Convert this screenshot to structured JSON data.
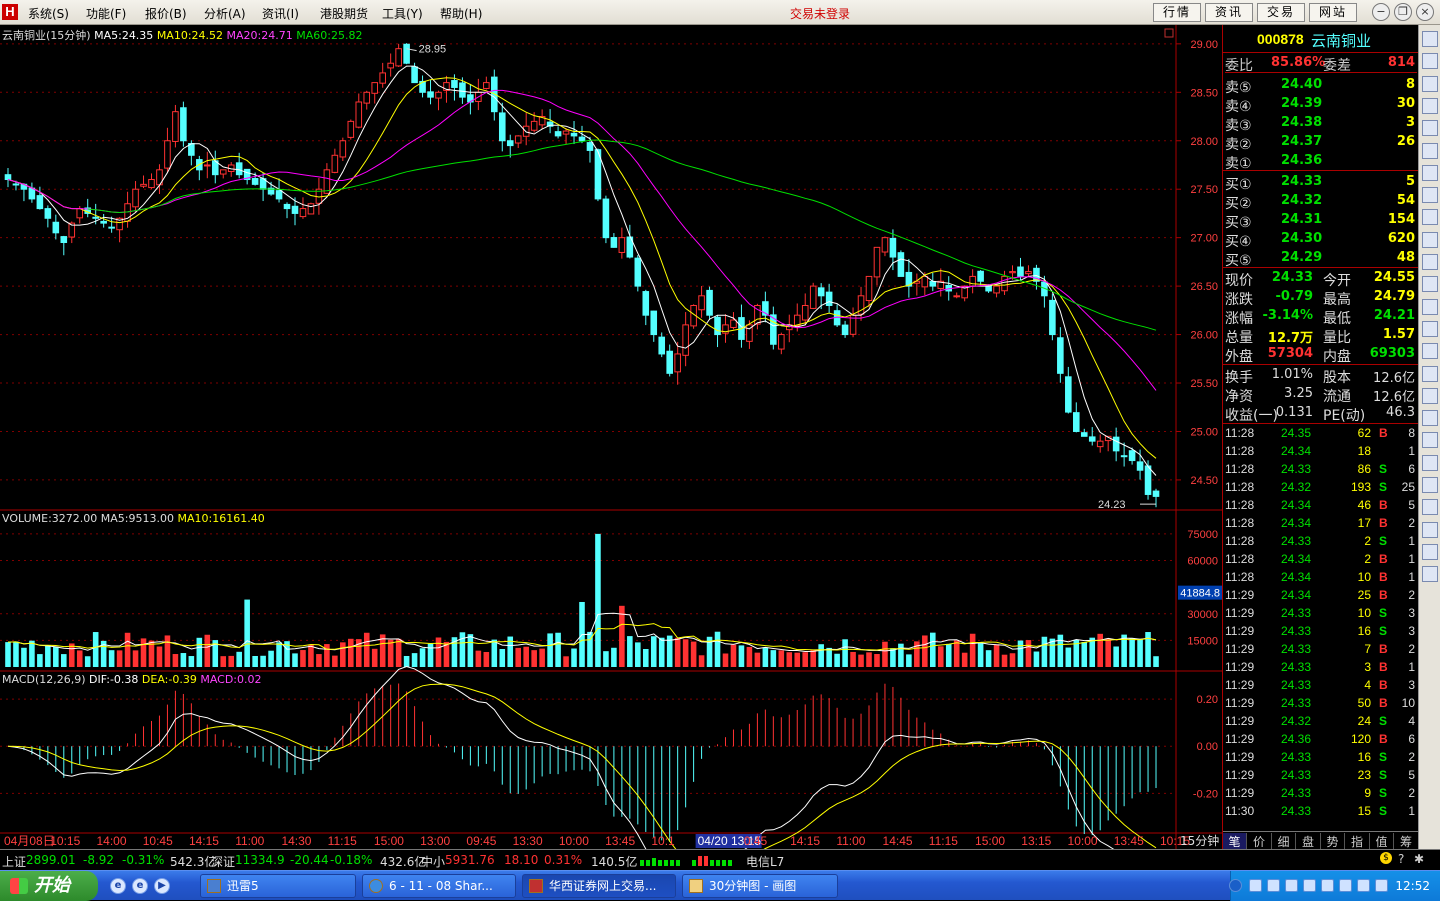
{
  "menu": {
    "items": [
      "系统(S)",
      "功能(F)",
      "报价(B)",
      "分析(A)",
      "资讯(I)",
      "港股期货",
      "工具(Y)",
      "帮助(H)"
    ],
    "login_status": "交易未登录",
    "buttons": [
      "行情",
      "资讯",
      "交易",
      "网站"
    ]
  },
  "chart": {
    "title": "云南铜业(15分钟)",
    "ma_labels": {
      "ma5": "MA5:24.35",
      "ma10": "MA10:24.52",
      "ma20": "MA20:24.71",
      "ma60": "MA60:25.82"
    },
    "high_label": "28.95",
    "low_label": "24.23",
    "price_ticks": [
      "29.00",
      "28.50",
      "28.00",
      "27.50",
      "27.00",
      "26.50",
      "26.00",
      "25.50",
      "25.00",
      "24.50"
    ],
    "volume_label": "VOLUME:3272.00",
    "vol_ma5_label": "MA5:9513.00",
    "vol_ma10_label": "MA10:16161.40",
    "vol_ticks": [
      "75000",
      "60000",
      "30000",
      "15000"
    ],
    "vol_cursor_value": "41884.8",
    "macd_label": "MACD(12,26,9)",
    "dif_label": "DIF:-0.38",
    "dea_label": "DEA:-0.39",
    "macd_value_label": "MACD:0.02",
    "macd_ticks": [
      "0.20",
      "0.00",
      "-0.20"
    ],
    "time_ticks": [
      "04月08日",
      "10:15",
      "14:00",
      "10:45",
      "14:15",
      "11:00",
      "14:30",
      "11:15",
      "15:00",
      "13:00",
      "09:45",
      "13:30",
      "10:00",
      "13:45",
      "10:1",
      "04/20 13:15",
      "0:45",
      "14:15",
      "11:00",
      "14:45",
      "11:15",
      "15:00",
      "13:15",
      "10:00",
      "13:45",
      "10:15"
    ],
    "period_label": "15分钟",
    "colors": {
      "up": "#ff3232",
      "down": "#54ffff",
      "ma5": "#ffffff",
      "ma10": "#ffff00",
      "ma20": "#ff00ff",
      "ma60": "#00e000",
      "grid": "#800000"
    }
  },
  "chart_data": {
    "type": "candlestick",
    "title": "云南铜业(15分钟)",
    "y_range": [
      24.2,
      29.05
    ],
    "price_close": [
      27.6,
      27.55,
      27.5,
      27.4,
      27.3,
      27.2,
      27.05,
      26.95,
      27.15,
      27.3,
      27.25,
      27.2,
      27.15,
      27.1,
      27.2,
      27.35,
      27.5,
      27.55,
      27.6,
      27.7,
      28.0,
      28.3,
      28.0,
      27.85,
      27.7,
      27.75,
      27.65,
      27.7,
      27.75,
      27.65,
      27.6,
      27.55,
      27.5,
      27.45,
      27.4,
      27.3,
      27.25,
      27.3,
      27.35,
      27.5,
      27.7,
      27.85,
      28.0,
      28.2,
      28.4,
      28.5,
      28.6,
      28.7,
      28.8,
      28.95,
      28.8,
      28.6,
      28.5,
      28.45,
      28.5,
      28.6,
      28.55,
      28.45,
      28.4,
      28.5,
      28.6,
      28.3,
      28.0,
      27.95,
      28.05,
      28.15,
      28.2,
      28.25,
      28.15,
      28.05,
      28.1,
      28.05,
      28.0,
      27.9,
      27.4,
      27.0,
      26.9,
      27.0,
      26.8,
      26.5,
      26.2,
      26.0,
      25.8,
      25.6,
      25.8,
      26.1,
      26.3,
      26.4,
      26.2,
      26.0,
      26.1,
      26.15,
      25.95,
      26.1,
      26.3,
      26.2,
      25.9,
      26.0,
      26.1,
      26.2,
      26.3,
      26.5,
      26.4,
      26.3,
      26.1,
      26.0,
      26.2,
      26.4,
      26.6,
      26.9,
      27.0,
      26.8,
      26.6,
      26.5,
      26.55,
      26.6,
      26.5,
      26.55,
      26.45,
      26.4,
      26.5,
      26.6,
      26.55,
      26.45,
      26.5,
      26.6,
      26.65,
      26.6,
      26.65,
      26.55,
      26.4,
      26.0,
      25.6,
      25.2,
      25.0,
      24.95,
      24.9,
      24.9,
      24.95,
      24.8,
      24.75,
      24.7,
      24.6,
      24.35,
      24.33
    ],
    "volume_range": [
      0,
      80000
    ],
    "macd": {
      "dif_last": -0.38,
      "dea_last": -0.39,
      "macd_last": 0.02,
      "y_range": [
        -0.36,
        0.26
      ]
    },
    "series": [
      {
        "name": "MA5",
        "last": 24.35
      },
      {
        "name": "MA10",
        "last": 24.52
      },
      {
        "name": "MA20",
        "last": 24.71
      },
      {
        "name": "MA60",
        "last": 25.82
      }
    ]
  },
  "panel": {
    "code": "000878",
    "name": "云南铜业",
    "weibi_label": "委比",
    "weibi_value": "85.86%",
    "weicha_label": "委差",
    "weicha_value": "814",
    "sells": [
      {
        "label": "卖⑤",
        "price": "24.40",
        "vol": "8"
      },
      {
        "label": "卖④",
        "price": "24.39",
        "vol": "30"
      },
      {
        "label": "卖③",
        "price": "24.38",
        "vol": "3"
      },
      {
        "label": "卖②",
        "price": "24.37",
        "vol": "26"
      },
      {
        "label": "卖①",
        "price": "24.36",
        "vol": ""
      }
    ],
    "buys": [
      {
        "label": "买①",
        "price": "24.33",
        "vol": "5"
      },
      {
        "label": "买②",
        "price": "24.32",
        "vol": "54"
      },
      {
        "label": "买③",
        "price": "24.31",
        "vol": "154"
      },
      {
        "label": "买④",
        "price": "24.30",
        "vol": "620"
      },
      {
        "label": "买⑤",
        "price": "24.29",
        "vol": "48"
      }
    ],
    "stats": [
      {
        "l1": "现价",
        "v1": "24.33",
        "c1": "#00e000",
        "l2": "今开",
        "v2": "24.55",
        "c2": "#ffff00"
      },
      {
        "l1": "涨跌",
        "v1": "-0.79",
        "c1": "#00e000",
        "l2": "最高",
        "v2": "24.79",
        "c2": "#ffff00"
      },
      {
        "l1": "涨幅",
        "v1": "-3.14%",
        "c1": "#00e000",
        "l2": "最低",
        "v2": "24.21",
        "c2": "#00e000"
      },
      {
        "l1": "总量",
        "v1": "12.7万",
        "c1": "#ffff00",
        "l2": "量比",
        "v2": "1.57",
        "c2": "#ffff00"
      },
      {
        "l1": "外盘",
        "v1": "57304",
        "c1": "#ff3232",
        "l2": "内盘",
        "v2": "69303",
        "c2": "#00e000"
      }
    ],
    "stats2": [
      {
        "l1": "换手",
        "v1": "1.01%",
        "l2": "股本",
        "v2": "12.6亿"
      },
      {
        "l1": "净资",
        "v1": "3.25",
        "l2": "流通",
        "v2": "12.6亿"
      },
      {
        "l1": "收益(一)",
        "v1": "0.131",
        "l2": "PE(动)",
        "v2": "46.3"
      }
    ],
    "ticks": [
      {
        "t": "11:28",
        "p": "24.35",
        "v": "62",
        "bs": "B",
        "n": "8"
      },
      {
        "t": "11:28",
        "p": "24.34",
        "v": "18",
        "bs": "",
        "n": "1"
      },
      {
        "t": "11:28",
        "p": "24.33",
        "v": "86",
        "bs": "S",
        "n": "6"
      },
      {
        "t": "11:28",
        "p": "24.32",
        "v": "193",
        "bs": "S",
        "n": "25"
      },
      {
        "t": "11:28",
        "p": "24.34",
        "v": "46",
        "bs": "B",
        "n": "5"
      },
      {
        "t": "11:28",
        "p": "24.34",
        "v": "17",
        "bs": "B",
        "n": "2"
      },
      {
        "t": "11:28",
        "p": "24.33",
        "v": "2",
        "bs": "S",
        "n": "1"
      },
      {
        "t": "11:28",
        "p": "24.34",
        "v": "2",
        "bs": "B",
        "n": "1"
      },
      {
        "t": "11:28",
        "p": "24.34",
        "v": "10",
        "bs": "B",
        "n": "1"
      },
      {
        "t": "11:29",
        "p": "24.34",
        "v": "25",
        "bs": "B",
        "n": "2"
      },
      {
        "t": "11:29",
        "p": "24.33",
        "v": "10",
        "bs": "S",
        "n": "3"
      },
      {
        "t": "11:29",
        "p": "24.33",
        "v": "16",
        "bs": "S",
        "n": "3"
      },
      {
        "t": "11:29",
        "p": "24.33",
        "v": "7",
        "bs": "B",
        "n": "2"
      },
      {
        "t": "11:29",
        "p": "24.33",
        "v": "3",
        "bs": "B",
        "n": "1"
      },
      {
        "t": "11:29",
        "p": "24.33",
        "v": "4",
        "bs": "B",
        "n": "3"
      },
      {
        "t": "11:29",
        "p": "24.33",
        "v": "50",
        "bs": "B",
        "n": "10"
      },
      {
        "t": "11:29",
        "p": "24.32",
        "v": "24",
        "bs": "S",
        "n": "4"
      },
      {
        "t": "11:29",
        "p": "24.36",
        "v": "120",
        "bs": "B",
        "n": "6"
      },
      {
        "t": "11:29",
        "p": "24.33",
        "v": "16",
        "bs": "S",
        "n": "2"
      },
      {
        "t": "11:29",
        "p": "24.33",
        "v": "23",
        "bs": "S",
        "n": "5"
      },
      {
        "t": "11:29",
        "p": "24.33",
        "v": "9",
        "bs": "S",
        "n": "2"
      },
      {
        "t": "11:30",
        "p": "24.33",
        "v": "15",
        "bs": "S",
        "n": "1"
      }
    ],
    "tabs": [
      "笔",
      "价",
      "细",
      "盘",
      "势",
      "指",
      "值",
      "筹"
    ]
  },
  "status": {
    "sh_label": "上证",
    "sh_val": "2899.01",
    "sh_chg": "-8.92",
    "sh_pct": "-0.31%",
    "sh_amt": "542.3亿",
    "sz_label": "深证",
    "sz_val": "11334.9",
    "sz_chg": "-20.44",
    "sz_pct": "-0.18%",
    "sz_amt": "432.6亿",
    "zx_label": "中小",
    "zx_val": "5931.76",
    "zx_chg": "18.10",
    "zx_pct": "0.31%",
    "zx_amt": "140.5亿",
    "server": "电信L7"
  },
  "taskbar": {
    "start": "开始",
    "tasks": [
      "迅雷5",
      "6 - 11 - 08 Shar...",
      "华西证券网上交易...",
      "30分钟图 - 画图"
    ],
    "clock": "12:52"
  },
  "toolstrip": {
    "icons": [
      "m1",
      "m2",
      "m3",
      "m4",
      "m5",
      "m6",
      "m7",
      "m8",
      "m9",
      "m10",
      "f10",
      "m12",
      "m13",
      "ex",
      "m15",
      "m16",
      "rsi",
      "m18",
      "m19",
      "dollar",
      "m21",
      "pen",
      "move",
      "up",
      "down"
    ]
  }
}
